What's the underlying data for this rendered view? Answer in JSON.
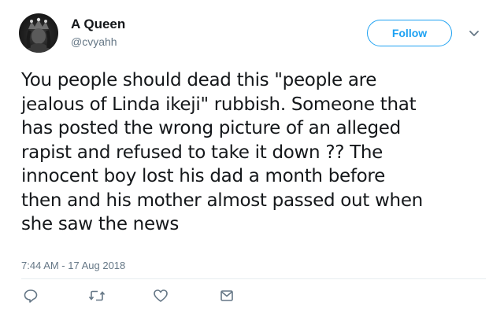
{
  "user": {
    "display_name": "A Queen",
    "handle": "@cvyahh",
    "avatar_icon": "avatar-photo-icon"
  },
  "follow_button": {
    "label": "Follow",
    "color": "#1da1f2"
  },
  "menu_icon": "chevron-down-icon",
  "tweet": {
    "lines": [
      "You people should dead this \"people are",
      "jealous of Linda ikeji\" rubbish. Someone that",
      "has posted the wrong picture of an alleged",
      "rapist and refused to take it down ?? The",
      "innocent boy lost his dad a month before",
      "then and his mother almost passed out when",
      "she saw the news"
    ],
    "timestamp": "7:44 AM - 17 Aug 2018"
  },
  "actions": [
    {
      "icon": "reply-icon"
    },
    {
      "icon": "retweet-icon"
    },
    {
      "icon": "like-icon"
    },
    {
      "icon": "message-icon"
    }
  ],
  "colors": {
    "text": "#14171a",
    "secondary": "#657786",
    "accent": "#1da1f2"
  }
}
